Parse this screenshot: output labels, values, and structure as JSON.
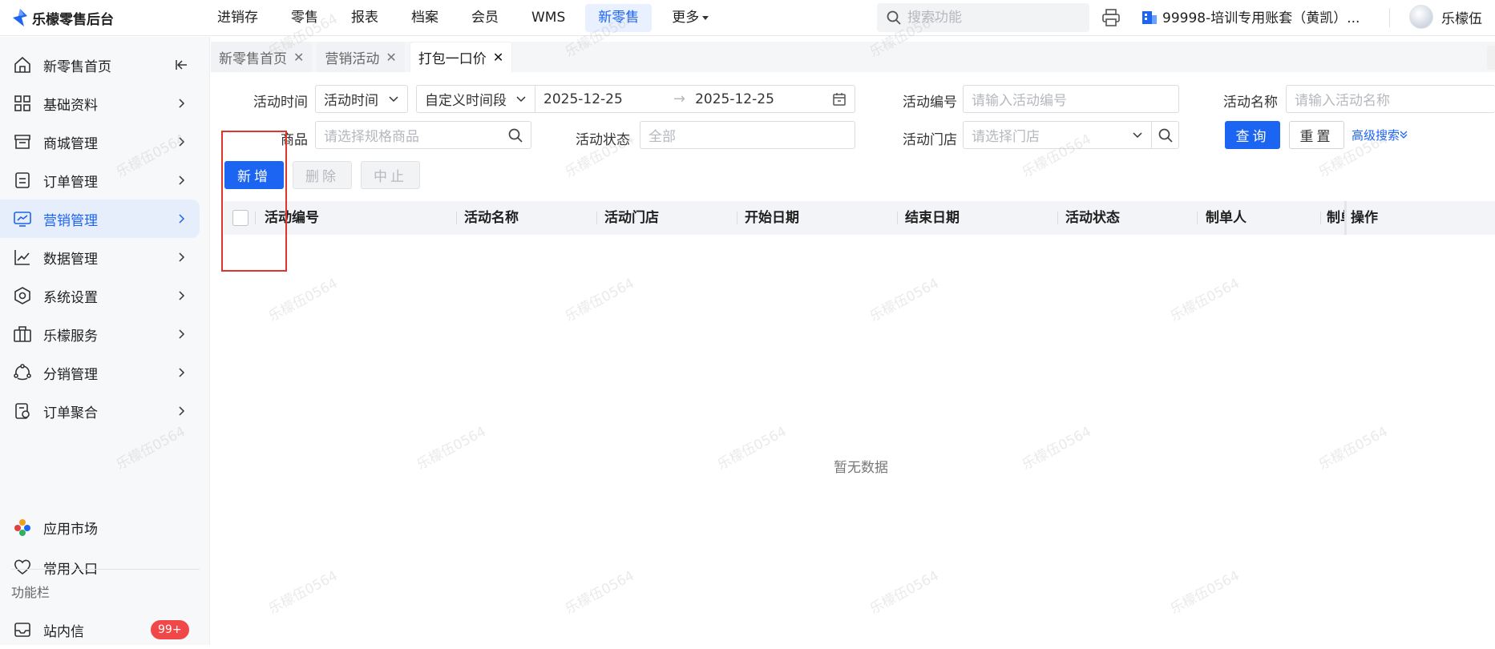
{
  "app": {
    "logo_text": "乐檬零售后台"
  },
  "topnav": {
    "items": [
      {
        "label": "进销存"
      },
      {
        "label": "零售"
      },
      {
        "label": "报表"
      },
      {
        "label": "档案"
      },
      {
        "label": "会员"
      },
      {
        "label": "WMS"
      },
      {
        "label": "新零售",
        "active": true
      },
      {
        "label": "更多"
      }
    ],
    "search_placeholder": "搜索功能",
    "account": "99998-培训专用账套（黄凯）...",
    "user": "乐檬伍"
  },
  "sidebar": {
    "items": [
      {
        "label": "新零售首页",
        "icon": "home-icon"
      },
      {
        "label": "基础资料",
        "icon": "grid-icon"
      },
      {
        "label": "商城管理",
        "icon": "store-icon"
      },
      {
        "label": "订单管理",
        "icon": "order-icon"
      },
      {
        "label": "营销管理",
        "icon": "marketing-icon",
        "active": true
      },
      {
        "label": "数据管理",
        "icon": "chart-line-icon"
      },
      {
        "label": "系统设置",
        "icon": "settings-icon"
      },
      {
        "label": "乐檬服务",
        "icon": "briefcase-icon"
      },
      {
        "label": "分销管理",
        "icon": "distribution-icon"
      },
      {
        "label": "订单聚合",
        "icon": "aggregate-icon"
      }
    ],
    "bottom": [
      {
        "label": "应用市场",
        "icon": "app-market-icon"
      },
      {
        "label": "常用入口",
        "icon": "heart-icon"
      }
    ],
    "section_label": "功能栏",
    "inbox": {
      "label": "站内信",
      "badge": "99+"
    }
  },
  "tabs": [
    {
      "label": "新零售首页"
    },
    {
      "label": "营销活动"
    },
    {
      "label": "打包一口价",
      "active": true
    }
  ],
  "filters": {
    "activity_time_label": "活动时间",
    "activity_time_select": "活动时间",
    "range_select": "自定义时间段",
    "date_start": "2025-12-25",
    "date_end": "2025-12-25",
    "activity_no_label": "活动编号",
    "activity_no_placeholder": "请输入活动编号",
    "activity_name_label": "活动名称",
    "activity_name_placeholder": "请输入活动名称",
    "product_label": "商品",
    "product_placeholder": "请选择规格商品",
    "status_label": "活动状态",
    "status_value": "全部",
    "store_label": "活动门店",
    "store_placeholder": "请选择门店",
    "query_btn": "查询",
    "reset_btn": "重置",
    "advanced_link": "高级搜索"
  },
  "actions": {
    "add": "新增",
    "delete": "删除",
    "stop": "中止"
  },
  "table": {
    "columns": [
      "活动编号",
      "活动名称",
      "活动门店",
      "开始日期",
      "结束日期",
      "活动状态",
      "制单人",
      "制单",
      "操作"
    ],
    "empty_text": "暂无数据"
  },
  "watermark": "乐檬伍0564",
  "colors": {
    "primary": "#1c64f2",
    "highlight_box": "#e0352b",
    "badge": "#f04848"
  }
}
